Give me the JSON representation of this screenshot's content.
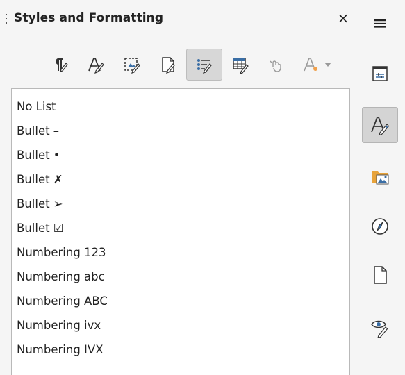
{
  "panel": {
    "title": "Styles and Formatting",
    "close_glyph": "×"
  },
  "toolbar": {
    "buttons": [
      {
        "name": "paragraph-styles-icon",
        "active": false
      },
      {
        "name": "character-styles-icon",
        "active": false
      },
      {
        "name": "frame-styles-icon",
        "active": false
      },
      {
        "name": "page-styles-icon",
        "active": false
      },
      {
        "name": "list-styles-icon",
        "active": true
      },
      {
        "name": "table-styles-icon",
        "active": false
      },
      {
        "name": "fill-format-mode-icon",
        "active": false,
        "disabled": true
      },
      {
        "name": "styles-actions-icon",
        "active": false,
        "disabled": true
      }
    ]
  },
  "list": {
    "items": [
      "No List",
      "Bullet –",
      "Bullet •",
      "Bullet ✗",
      "Bullet ➢",
      "Bullet ☑",
      "Numbering 123",
      "Numbering abc",
      "Numbering ABC",
      "Numbering ivx",
      "Numbering IVX"
    ]
  },
  "sidebar": {
    "menu_glyph": "≡",
    "tabs": [
      {
        "name": "properties-icon",
        "active": false
      },
      {
        "name": "styles-icon",
        "active": true
      },
      {
        "name": "gallery-icon",
        "active": false
      },
      {
        "name": "navigator-icon",
        "active": false
      },
      {
        "name": "page-icon",
        "active": false
      },
      {
        "name": "style-inspector-icon",
        "active": false
      }
    ]
  },
  "colors": {
    "accent": "#3a6ea5",
    "gallery_folder": "#e8a33a",
    "disabled": "#9a9a9a"
  }
}
